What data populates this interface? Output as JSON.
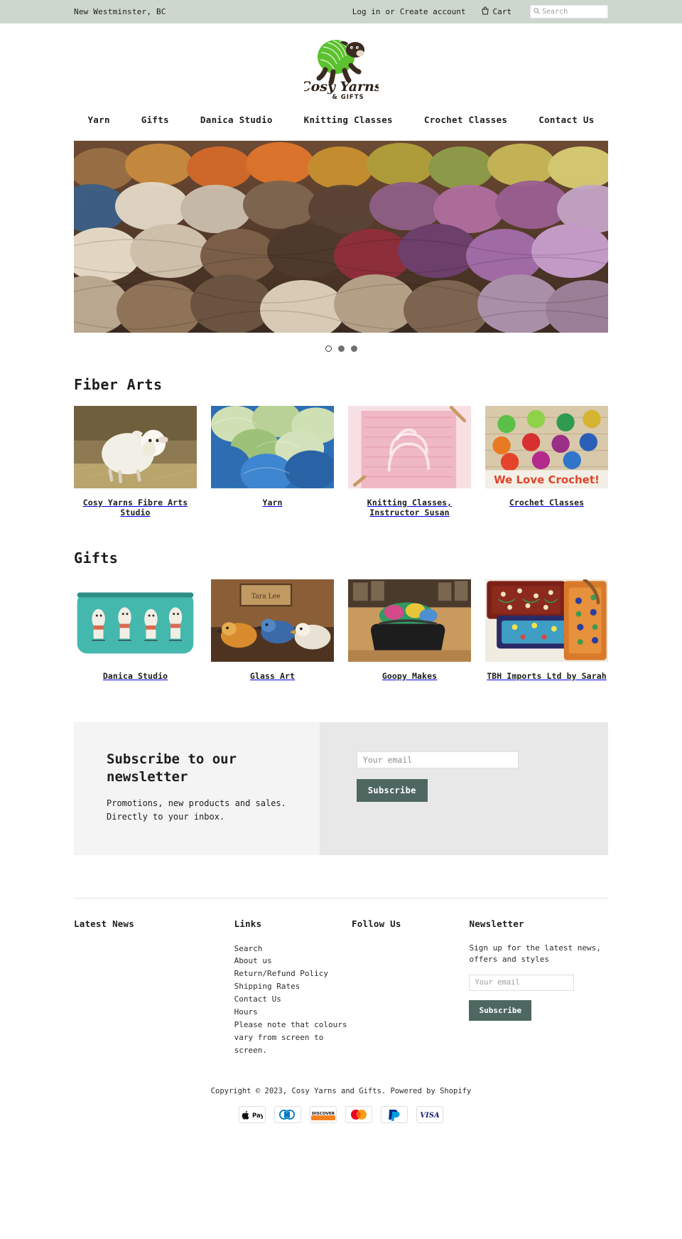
{
  "topbar": {
    "location": "New Westminster, BC",
    "login_label": "Log in",
    "or_label": "or",
    "create_account_label": "Create account",
    "cart_label": "Cart",
    "cart_icon": "cart-icon",
    "search_icon": "search-icon",
    "search_placeholder": "Search",
    "bg_color": "#cdd7cd"
  },
  "logo": {
    "brand_line1": "Cosy Yarns",
    "brand_line2": "& GIFTS",
    "alt": "Cosy Yarns and Gifts sheep logo"
  },
  "nav": {
    "items": [
      {
        "label": "Yarn"
      },
      {
        "label": "Gifts"
      },
      {
        "label": "Danica Studio"
      },
      {
        "label": "Knitting Classes"
      },
      {
        "label": "Crochet Classes"
      },
      {
        "label": "Contact Us"
      }
    ]
  },
  "hero": {
    "alt": "Shelves of colourful hand-dyed yarn skeins",
    "slide_count": 3,
    "active_slide": 1
  },
  "sections": [
    {
      "title": "Fiber Arts",
      "items": [
        {
          "caption": "Cosy Yarns Fibre Arts Studio",
          "alt": "White lamb in straw"
        },
        {
          "caption": "Yarn",
          "alt": "Blue and green yarn skeins"
        },
        {
          "caption": "Knitting Classes, Instructor Susan",
          "alt": "Pink knitted cable swatch on needles"
        },
        {
          "caption": "Crochet Classes",
          "alt": "Crocheted hearts with We Love Crochet banner"
        }
      ]
    },
    {
      "title": "Gifts",
      "items": [
        {
          "caption": "Danica Studio",
          "alt": "Teal llama print zip pouch"
        },
        {
          "caption": "Glass Art",
          "alt": "Glass bird figurines on a shelf"
        },
        {
          "caption": "Goopy Makes",
          "alt": "Black project bag full of yarn"
        },
        {
          "caption": "TBH Imports Ltd by Sarah",
          "alt": "Embroidered floral pouches"
        }
      ]
    }
  ],
  "newsletter_panel": {
    "heading": "Subscribe to our newsletter",
    "body": "Promotions, new products and sales. Directly to your inbox.",
    "email_placeholder": "Your email",
    "email_value": "",
    "subscribe_label": "Subscribe",
    "accent_color": "#4e6761"
  },
  "footer": {
    "columns": [
      {
        "heading": "Latest News",
        "links": []
      },
      {
        "heading": "Links",
        "links": [
          {
            "label": "Search"
          },
          {
            "label": "About us"
          },
          {
            "label": "Return/Refund Policy"
          },
          {
            "label": "Shipping Rates"
          },
          {
            "label": "Contact Us"
          },
          {
            "label": "Hours"
          }
        ],
        "note": "Please note that colours vary from screen to screen."
      },
      {
        "heading": "Follow Us",
        "links": []
      },
      {
        "heading": "Newsletter",
        "blurb": "Sign up for the latest news, offers and styles",
        "email_placeholder": "Your email",
        "email_value": "",
        "subscribe_label": "Subscribe"
      }
    ],
    "copyright": "Copyright © 2023, Cosy Yarns and Gifts. Powered by Shopify",
    "payment_methods": [
      {
        "name": "apple-pay-icon",
        "label": "Pay"
      },
      {
        "name": "diners-club-icon",
        "label": "Diners"
      },
      {
        "name": "discover-icon",
        "label": "DISCOVER"
      },
      {
        "name": "mastercard-icon",
        "label": "Mastercard"
      },
      {
        "name": "paypal-icon",
        "label": "PayPal"
      },
      {
        "name": "visa-icon",
        "label": "VISA"
      }
    ]
  }
}
